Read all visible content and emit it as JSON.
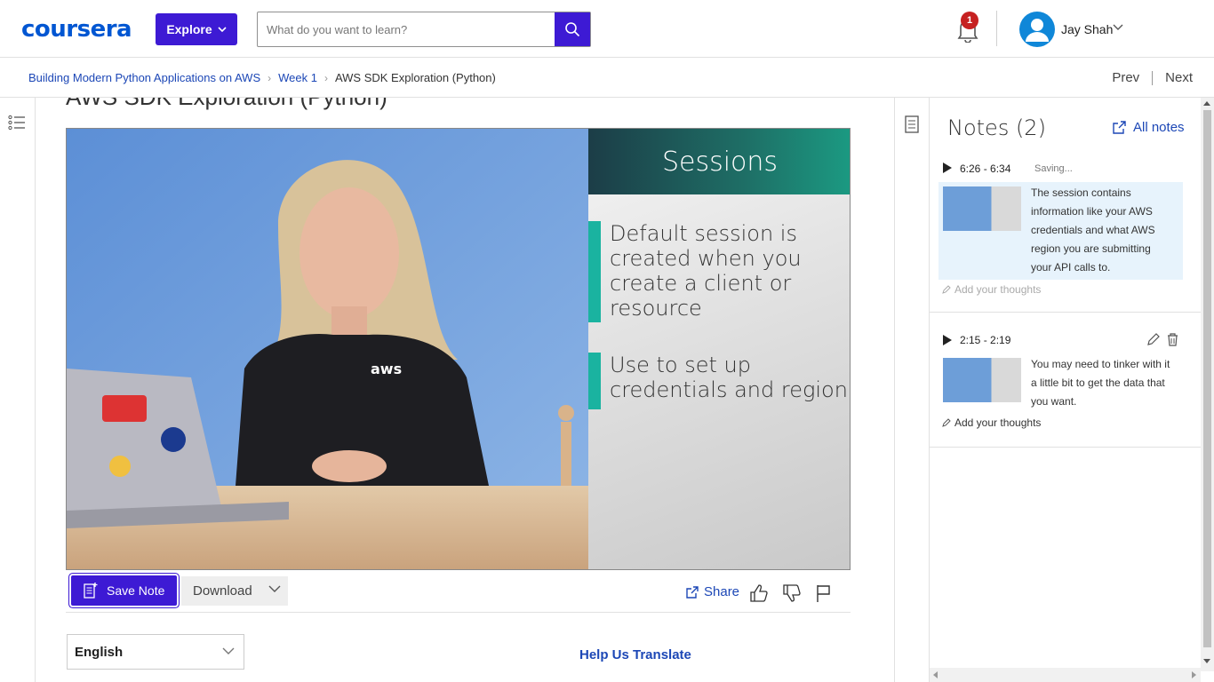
{
  "header": {
    "logo": "coursera",
    "explore_label": "Explore",
    "search_placeholder": "What do you want to learn?",
    "notification_count": "1",
    "user_name": "Jay Shah"
  },
  "breadcrumb": {
    "items": [
      "Building Modern Python Applications on AWS",
      "Week 1",
      "AWS SDK Exploration (Python)"
    ],
    "prev": "Prev",
    "next": "Next"
  },
  "main": {
    "title": "AWS SDK Exploration (Python)",
    "video": {
      "slide_title": "Sessions",
      "bullets": [
        "Default session is created when you create a client or resource",
        "Use to set up credentials and region"
      ],
      "shirt_logo": "aws"
    },
    "actions": {
      "save_note": "Save Note",
      "download": "Download",
      "share": "Share"
    },
    "language": "English",
    "help_translate": "Help Us Translate"
  },
  "notes": {
    "title": "Notes (2)",
    "all_notes": "All notes",
    "items": [
      {
        "time": "6:26 - 6:34",
        "status": "Saving...",
        "text": "The session contains information like your AWS credentials and what AWS region you are submitting your API calls to.",
        "add_thoughts": "Add your thoughts"
      },
      {
        "time": "2:15 - 2:19",
        "text": "You may need to tinker with it a little bit to get the data that you want.",
        "add_thoughts": "Add your thoughts"
      }
    ]
  },
  "colors": {
    "brand": "#0056d2",
    "primary_button": "#3d1ad4",
    "link": "#1c47b6",
    "note_highlight": "#e7f3fc",
    "badge": "#c62020"
  }
}
